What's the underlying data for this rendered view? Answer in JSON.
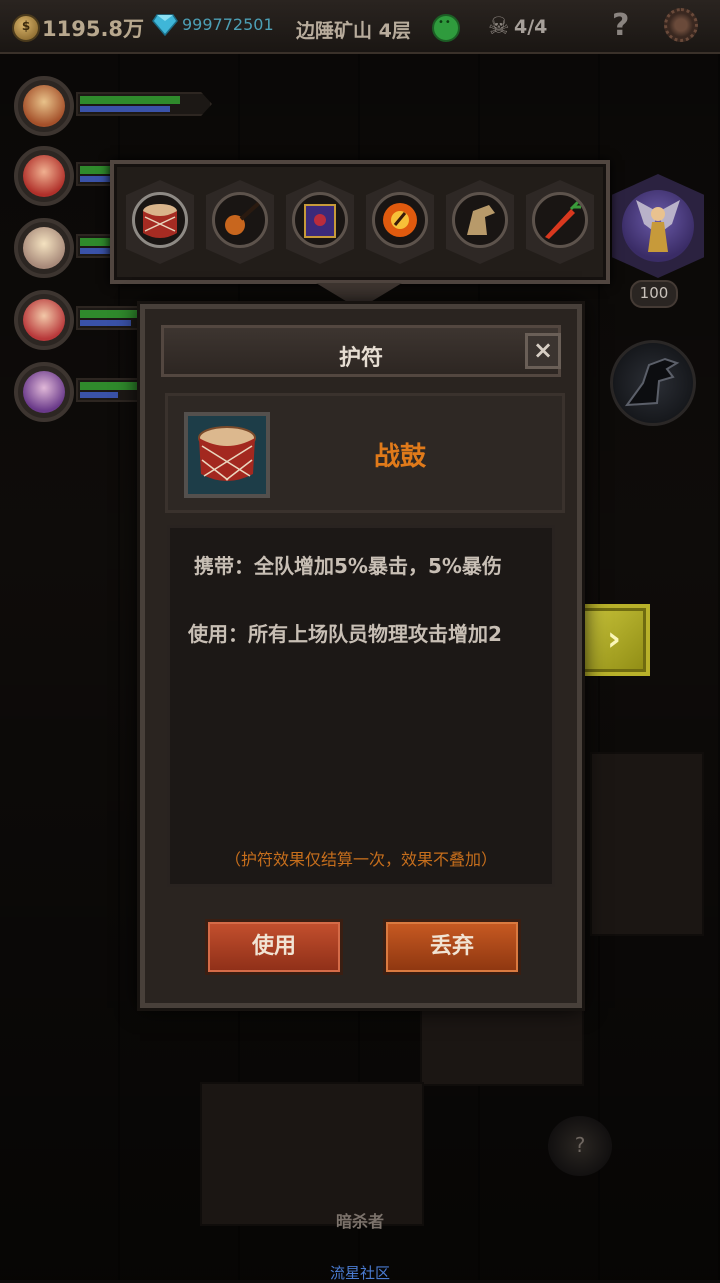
{
  "topbar": {
    "gold": "1195.8万",
    "diamonds": "999772501",
    "location": "边陲矿山 4层",
    "kills": "4/4",
    "help": "?"
  },
  "heroes": [
    {
      "hp": 0.78,
      "mp": 0.7
    },
    {
      "hp": 0.55,
      "mp": 0.4
    },
    {
      "hp": 0.6,
      "mp": 0.35
    },
    {
      "hp": 0.55,
      "mp": 0.4
    },
    {
      "hp": 0.45,
      "mp": 0.3
    }
  ],
  "amulet_slots": [
    "war-drum",
    "smoking-pipe",
    "spell-book",
    "fire-orb",
    "griffin-head",
    "carrot-spear"
  ],
  "side": {
    "angel_score": "100",
    "next_arrow": "›"
  },
  "dialog": {
    "title": "护符",
    "close": "×",
    "item_name": "战鼓",
    "carry_effect": "携带：全队增加5%暴击，5%暴伤",
    "use_effect": "使用：所有上场队员物理攻击增加2",
    "note": "（护符效果仅结算一次，效果不叠加）",
    "use_button": "使用",
    "discard_button": "丢弃"
  },
  "bottom": {
    "enemy_name": "暗杀者",
    "mystery": "?",
    "community_link": "流星社区"
  },
  "colors": {
    "item_name": "#e07a1a",
    "note": "#c66e1c",
    "next_button": "#c9c43b",
    "link": "#4a7bd0"
  }
}
